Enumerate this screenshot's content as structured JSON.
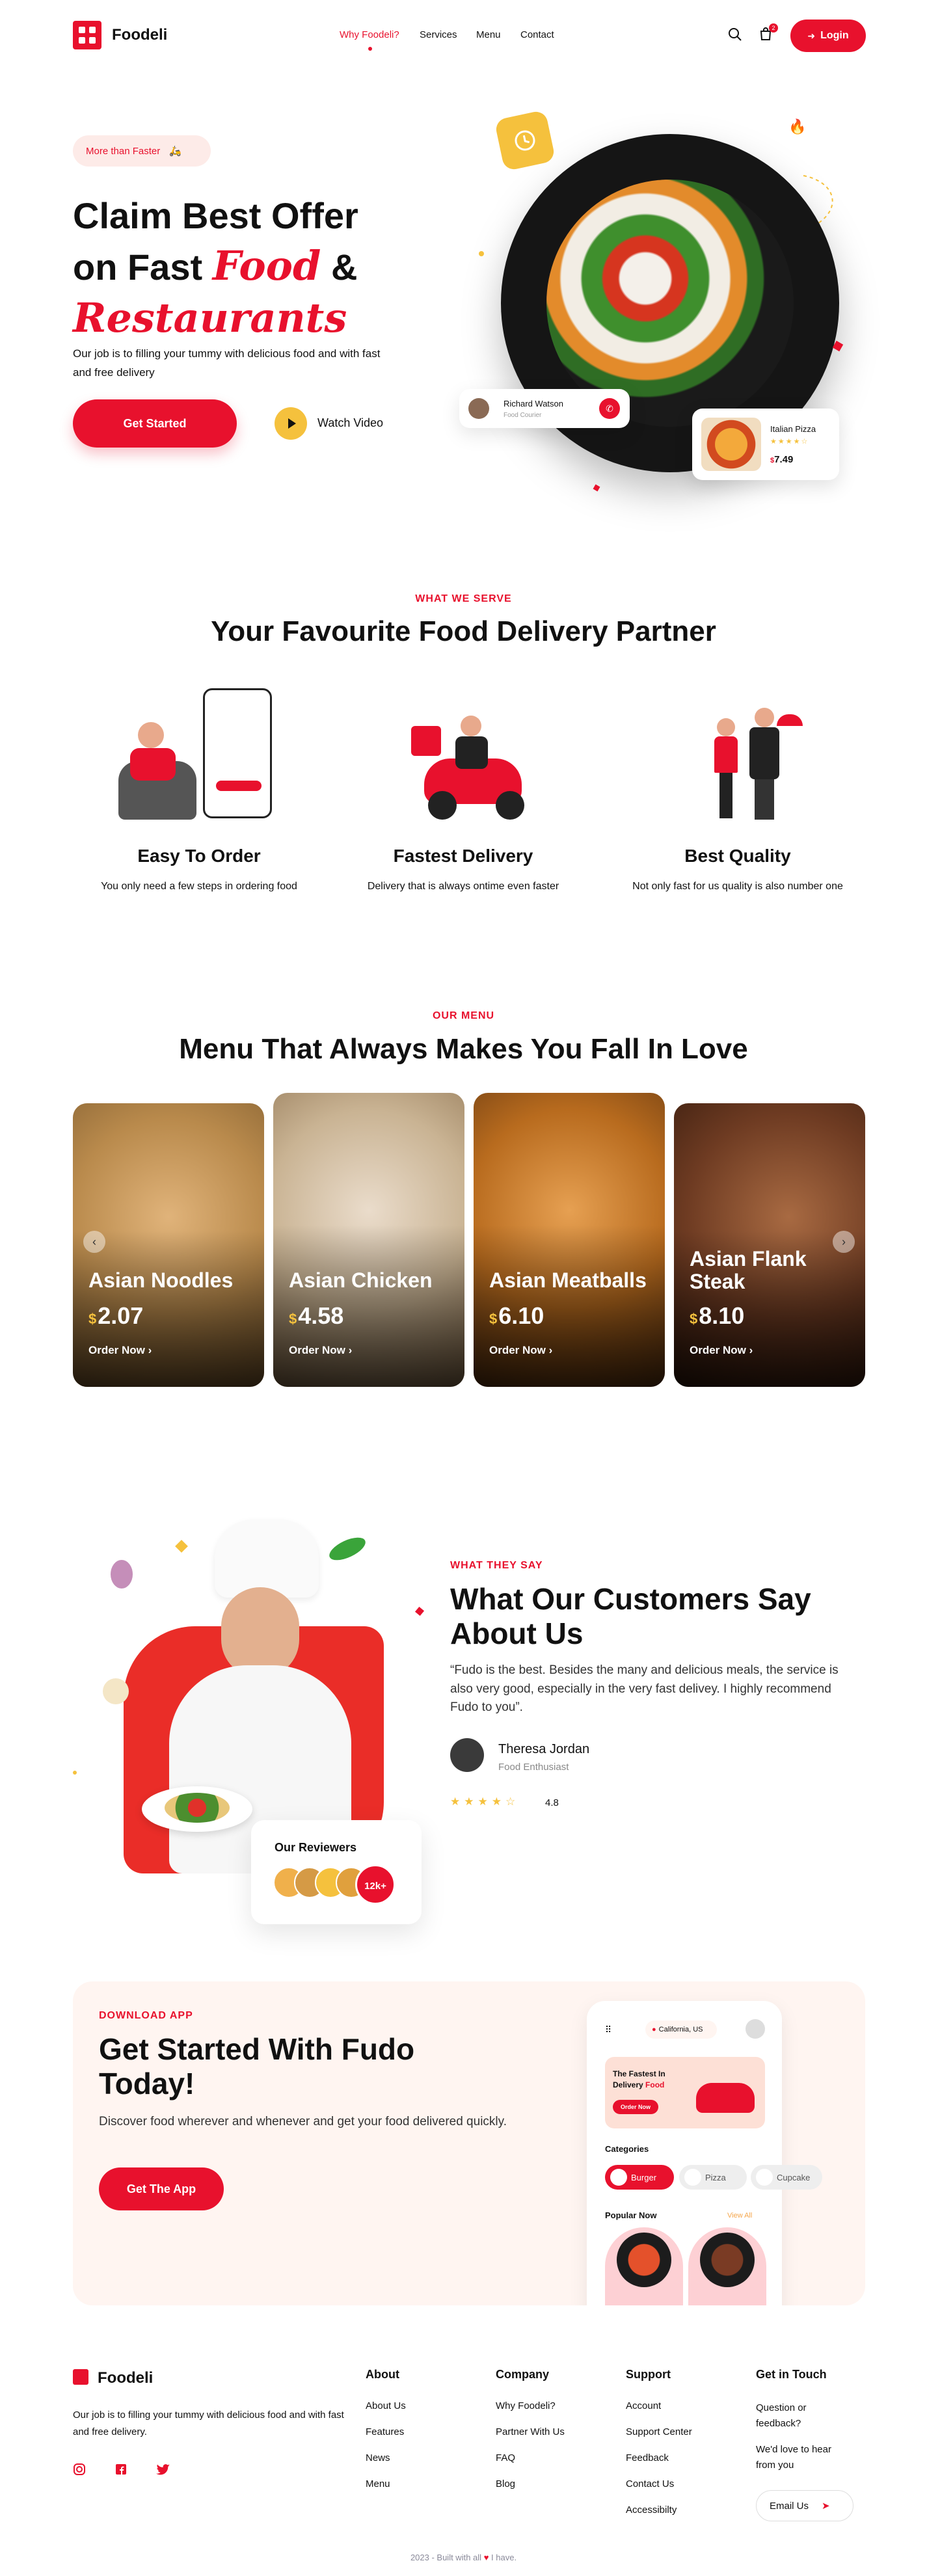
{
  "header": {
    "brand": "Foodeli",
    "nav": [
      "Why Foodeli?",
      "Services",
      "Menu",
      "Contact"
    ],
    "cart_count": "2",
    "login_label": "Login"
  },
  "hero": {
    "badge": "More than Faster",
    "title_line1": "Claim Best Offer",
    "title_line2a": "on Fast",
    "title_line2b": "Food",
    "title_line2c": "&",
    "title_line3": "Restaurants",
    "subtitle": "Our job is to filling your tummy with delicious food and with fast and free delivery",
    "cta": "Get Started",
    "watch": "Watch Video",
    "courier_name": "Richard Watson",
    "courier_role": "Food Courier",
    "item_name": "Italian Pizza",
    "item_price_symbol": "$",
    "item_price": "7.49",
    "item_rating": "4"
  },
  "services": {
    "eyebrow": "WHAT WE SERVE",
    "heading": "Your Favourite Food Delivery Partner",
    "items": [
      {
        "title": "Easy To Order",
        "desc": "You only need a few steps in ordering food"
      },
      {
        "title": "Fastest Delivery",
        "desc": "Delivery that is always ontime even faster"
      },
      {
        "title": "Best Quality",
        "desc": "Not only fast for us quality is also number one"
      }
    ]
  },
  "menu": {
    "eyebrow": "OUR MENU",
    "heading": "Menu That Always Makes You Fall In Love",
    "order_label": "Order Now",
    "currency": "$",
    "items": [
      {
        "name": "Asian Noodles",
        "price": "2.07",
        "color": "#b98a4c"
      },
      {
        "name": "Asian Chicken",
        "price": "4.58",
        "color": "#c9b393"
      },
      {
        "name": "Asian Meatballs",
        "price": "6.10",
        "color": "#b86b1e"
      },
      {
        "name": "Asian Flank Steak",
        "price": "8.10",
        "color": "#6e3b22"
      }
    ]
  },
  "testimonial": {
    "eyebrow": "WHAT THEY SAY",
    "heading_line1": "What Our Customers Say",
    "heading_line2": "About Us",
    "quote": "“Fudo is the best. Besides the many and delicious meals, the service is also very good, especially in the very fast delivey. I highly recommend Fudo to you”.",
    "name": "Theresa Jordan",
    "role": "Food Enthusiast",
    "rating": "4.8",
    "reviewers_label": "Our Reviewers",
    "reviewers_count": "12k+"
  },
  "download": {
    "eyebrow": "DOWNLOAD APP",
    "heading_line1": "Get Started With Fudo",
    "heading_line2": "Today!",
    "desc": "Discover food wherever and whenever and get your food delivered quickly.",
    "cta": "Get The App",
    "phone": {
      "location": "California, US",
      "banner_line1": "The Fastest In",
      "banner_line2a": "Delivery",
      "banner_line2b": "Food",
      "banner_cta": "Order Now",
      "categories_label": "Categories",
      "categories": [
        "Burger",
        "Pizza",
        "Cupcake"
      ],
      "popular_label": "Popular Now",
      "view_all": "View All"
    }
  },
  "footer": {
    "brand": "Foodeli",
    "desc": "Our job is to filling your tummy with delicious food and with fast and free delivery.",
    "columns": [
      {
        "title": "About",
        "links": [
          "About Us",
          "Features",
          "News",
          "Menu"
        ]
      },
      {
        "title": "Company",
        "links": [
          "Why Foodeli?",
          "Partner With Us",
          "FAQ",
          "Blog"
        ]
      },
      {
        "title": "Support",
        "links": [
          "Account",
          "Support Center",
          "Feedback",
          "Contact Us",
          "Accessibilty"
        ]
      }
    ],
    "contact_title": "Get in Touch",
    "contact_q": "Question or feedback?",
    "contact_hear": "We'd love to hear from you",
    "email_placeholder": "Email Us",
    "copyright_a": "2023 - Built with all",
    "copyright_b": "I have."
  },
  "colors": {
    "accent": "#e8112d",
    "yellow": "#f5c13d"
  }
}
